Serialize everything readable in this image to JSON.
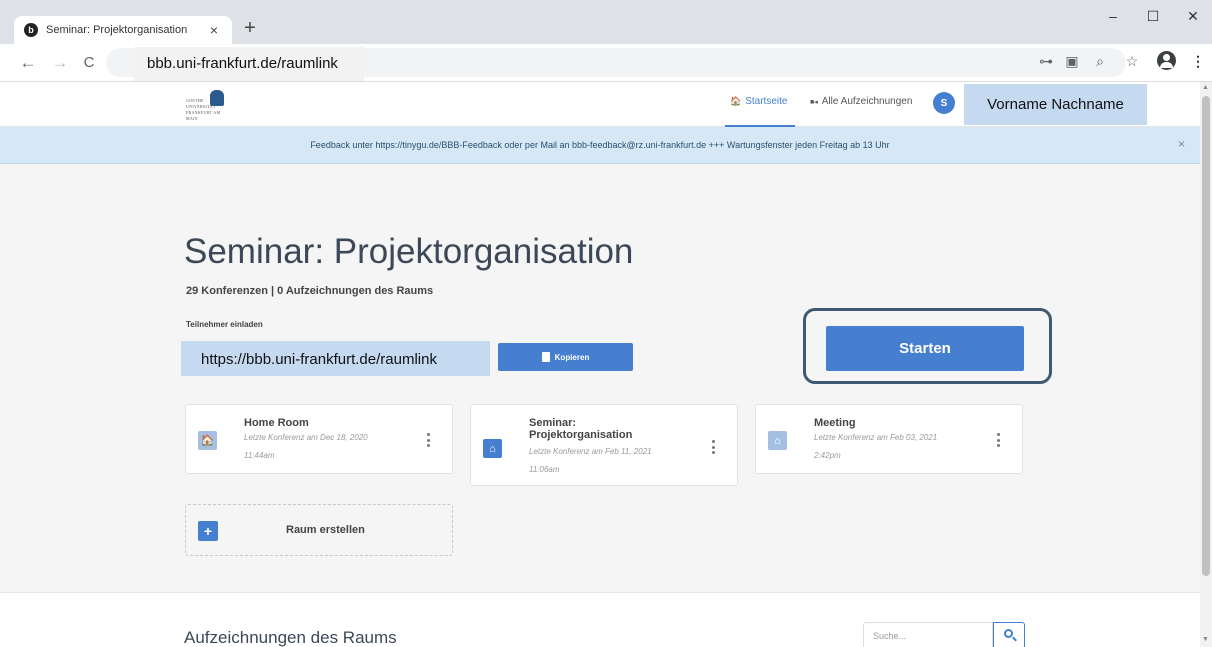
{
  "browser": {
    "tab_title": "Seminar: Projektorganisation",
    "tab_close": "×",
    "new_tab": "+",
    "url": "bbb.uni-frankfurt.de/raumlink",
    "window_controls": {
      "minimize": "–",
      "maximize": "☐",
      "close": "✕"
    },
    "nav": {
      "back": "←",
      "forward": "→",
      "reload": "C"
    },
    "toolbar_icons": {
      "key": "⊶",
      "translate": "▣",
      "zoom": "⌕",
      "star": "☆",
      "menu": "⋮"
    }
  },
  "navbar": {
    "logo_text": "GOETHE UNIVERSITÄT FRANKFURT AM MAIN",
    "links": [
      {
        "icon": "🏠",
        "label": "Startseite"
      },
      {
        "icon": "■◂",
        "label": "Alle Aufzeichnungen"
      }
    ],
    "avatar_initial": "S",
    "user_name": "Vorname Nachname"
  },
  "banner": {
    "text": "Feedback unter https://tinygu.de/BBB-Feedback oder per Mail an bbb-feedback@rz.uni-frankfurt.de +++ Wartungsfenster jeden Freitag ab 13 Uhr",
    "close": "×"
  },
  "room": {
    "title": "Seminar: Projektorganisation",
    "stats": "29 Konferenzen | 0 Aufzeichnungen des Raums",
    "invite_label": "Teilnehmer einladen",
    "invite_link": "https://bbb.uni-frankfurt.de/raumlink",
    "copy_label": "Kopieren",
    "start_label": "Starten"
  },
  "rooms": [
    {
      "name_line1": "Home Room",
      "name_line2": "",
      "date_line1": "Letzte Konferenz am Dec 18, 2020",
      "date_line2": "11:44am",
      "icon": "🏠"
    },
    {
      "name_line1": "Seminar:",
      "name_line2": "Projektorganisation",
      "date_line1": "Letzte Konferenz am Feb 11, 2021",
      "date_line2": "11:06am",
      "icon": "⌂"
    },
    {
      "name_line1": "Meeting",
      "name_line2": "",
      "date_line1": "Letzte Konferenz am Feb 03, 2021",
      "date_line2": "2:42pm",
      "icon": "⌂"
    }
  ],
  "create_room": {
    "icon": "+",
    "label": "Raum erstellen"
  },
  "recordings": {
    "title": "Aufzeichnungen des Raums",
    "search_placeholder": "Suche..."
  },
  "colors": {
    "accent": "#467fcf",
    "highlight": "#c5d9f1",
    "banner": "#d6e8f5",
    "frame": "#3e5a72"
  }
}
